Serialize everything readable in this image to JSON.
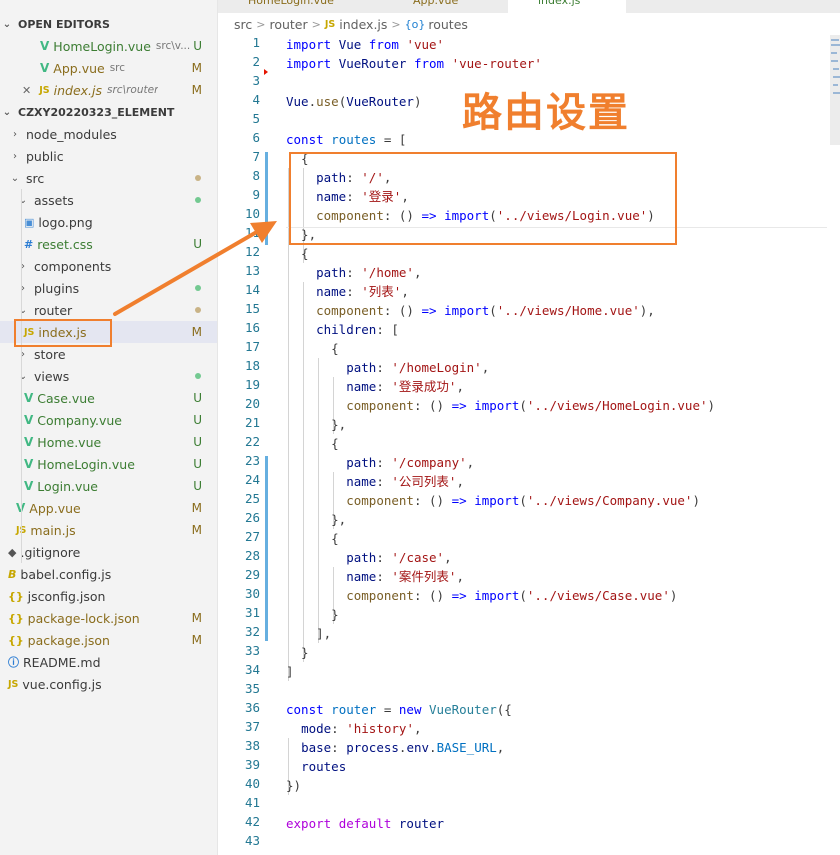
{
  "tabs": [
    {
      "label": "HomeLogin.vue"
    },
    {
      "label": "App.vue"
    },
    {
      "label": "index.js"
    }
  ],
  "breadcrumb": {
    "part1": "src",
    "part2": "router",
    "part3": "index.js",
    "part4": "routes",
    "js_icon": "JS",
    "obj_icon": "{o}"
  },
  "explorer": {
    "open_editors_title": "OPEN EDITORS",
    "project_title": "CZXY20220323_ELEMENT",
    "open_editors": [
      {
        "name": "HomeLogin.vue",
        "path": "src\\v...",
        "status": "U",
        "icon": "vue-icon"
      },
      {
        "name": "App.vue",
        "path": "src",
        "status": "M",
        "icon": "vue-icon"
      },
      {
        "name": "index.js",
        "path": "src\\router",
        "status": "M",
        "icon": "js-icon",
        "close": "✕"
      }
    ],
    "tree": [
      {
        "name": "node_modules",
        "type": "folder",
        "expanded": false
      },
      {
        "name": "public",
        "type": "folder",
        "expanded": false
      },
      {
        "name": "src",
        "type": "folder",
        "expanded": true,
        "dot": "tan"
      },
      {
        "name": "assets",
        "type": "folder",
        "expanded": true,
        "dot": "green"
      },
      {
        "name": "logo.png",
        "type": "file",
        "icon": "image-icon"
      },
      {
        "name": "reset.css",
        "type": "file",
        "icon": "css-icon",
        "status": "U"
      },
      {
        "name": "components",
        "type": "folder",
        "expanded": false
      },
      {
        "name": "plugins",
        "type": "folder",
        "expanded": false,
        "dot": "green"
      },
      {
        "name": "router",
        "type": "folder",
        "expanded": true,
        "dot": "tan"
      },
      {
        "name": "index.js",
        "type": "file",
        "icon": "js-icon",
        "status": "M",
        "selected": true
      },
      {
        "name": "store",
        "type": "folder",
        "expanded": false
      },
      {
        "name": "views",
        "type": "folder",
        "expanded": true,
        "dot": "green"
      },
      {
        "name": "Case.vue",
        "type": "file",
        "icon": "vue-icon",
        "status": "U"
      },
      {
        "name": "Company.vue",
        "type": "file",
        "icon": "vue-icon",
        "status": "U"
      },
      {
        "name": "Home.vue",
        "type": "file",
        "icon": "vue-icon",
        "status": "U"
      },
      {
        "name": "HomeLogin.vue",
        "type": "file",
        "icon": "vue-icon",
        "status": "U"
      },
      {
        "name": "Login.vue",
        "type": "file",
        "icon": "vue-icon",
        "status": "U"
      },
      {
        "name": "App.vue",
        "type": "file",
        "icon": "vue-icon",
        "status": "M"
      },
      {
        "name": "main.js",
        "type": "file",
        "icon": "js-icon",
        "status": "M"
      },
      {
        "name": ".gitignore",
        "type": "file",
        "icon": "git-icon"
      },
      {
        "name": "babel.config.js",
        "type": "file",
        "icon": "babel-icon"
      },
      {
        "name": "jsconfig.json",
        "type": "file",
        "icon": "json-icon"
      },
      {
        "name": "package-lock.json",
        "type": "file",
        "icon": "json-icon",
        "status": "M"
      },
      {
        "name": "package.json",
        "type": "file",
        "icon": "json-icon",
        "status": "M"
      },
      {
        "name": "README.md",
        "type": "file",
        "icon": "info-icon"
      },
      {
        "name": "vue.config.js",
        "type": "file",
        "icon": "js-icon"
      }
    ]
  },
  "overlay_title": "路由设置",
  "code": [
    [
      [
        "kw",
        "import"
      ],
      [
        "pl",
        " "
      ],
      [
        "var",
        "Vue"
      ],
      [
        "pl",
        " "
      ],
      [
        "kw",
        "from"
      ],
      [
        "pl",
        " "
      ],
      [
        "str",
        "'vue'"
      ]
    ],
    [
      [
        "kw",
        "import"
      ],
      [
        "pl",
        " "
      ],
      [
        "var",
        "VueRouter"
      ],
      [
        "pl",
        " "
      ],
      [
        "kw",
        "from"
      ],
      [
        "pl",
        " "
      ],
      [
        "str",
        "'vue-router'"
      ]
    ],
    [],
    [
      [
        "var",
        "Vue"
      ],
      [
        "pl",
        "."
      ],
      [
        "fn",
        "use"
      ],
      [
        "pl",
        "("
      ],
      [
        "var",
        "VueRouter"
      ],
      [
        "pl",
        ")"
      ]
    ],
    [],
    [
      [
        "kw",
        "const"
      ],
      [
        "pl",
        " "
      ],
      [
        "cst",
        "routes"
      ],
      [
        "pl",
        " = ["
      ]
    ],
    [
      [
        "pl",
        "  {"
      ]
    ],
    [
      [
        "pl",
        "    "
      ],
      [
        "prop",
        "path"
      ],
      [
        "pl",
        ": "
      ],
      [
        "str",
        "'/'"
      ],
      [
        "pl",
        ","
      ]
    ],
    [
      [
        "pl",
        "    "
      ],
      [
        "prop",
        "name"
      ],
      [
        "pl",
        ": "
      ],
      [
        "str",
        "'登录'"
      ],
      [
        "pl",
        ","
      ]
    ],
    [
      [
        "pl",
        "    "
      ],
      [
        "fn",
        "component"
      ],
      [
        "pl",
        ": () "
      ],
      [
        "kw",
        "=>"
      ],
      [
        "pl",
        " "
      ],
      [
        "kw",
        "import"
      ],
      [
        "pl",
        "("
      ],
      [
        "str",
        "'../views/Login.vue'"
      ],
      [
        "pl",
        ")"
      ]
    ],
    [
      [
        "pl",
        "  },"
      ]
    ],
    [
      [
        "pl",
        "  {"
      ]
    ],
    [
      [
        "pl",
        "    "
      ],
      [
        "prop",
        "path"
      ],
      [
        "pl",
        ": "
      ],
      [
        "str",
        "'/home'"
      ],
      [
        "pl",
        ","
      ]
    ],
    [
      [
        "pl",
        "    "
      ],
      [
        "prop",
        "name"
      ],
      [
        "pl",
        ": "
      ],
      [
        "str",
        "'列表'"
      ],
      [
        "pl",
        ","
      ]
    ],
    [
      [
        "pl",
        "    "
      ],
      [
        "fn",
        "component"
      ],
      [
        "pl",
        ": () "
      ],
      [
        "kw",
        "=>"
      ],
      [
        "pl",
        " "
      ],
      [
        "kw",
        "import"
      ],
      [
        "pl",
        "("
      ],
      [
        "str",
        "'../views/Home.vue'"
      ],
      [
        "pl",
        "),"
      ]
    ],
    [
      [
        "pl",
        "    "
      ],
      [
        "prop",
        "children"
      ],
      [
        "pl",
        ": ["
      ]
    ],
    [
      [
        "pl",
        "      {"
      ]
    ],
    [
      [
        "pl",
        "        "
      ],
      [
        "prop",
        "path"
      ],
      [
        "pl",
        ": "
      ],
      [
        "str",
        "'/homeLogin'"
      ],
      [
        "pl",
        ","
      ]
    ],
    [
      [
        "pl",
        "        "
      ],
      [
        "prop",
        "name"
      ],
      [
        "pl",
        ": "
      ],
      [
        "str",
        "'登录成功'"
      ],
      [
        "pl",
        ","
      ]
    ],
    [
      [
        "pl",
        "        "
      ],
      [
        "fn",
        "component"
      ],
      [
        "pl",
        ": () "
      ],
      [
        "kw",
        "=>"
      ],
      [
        "pl",
        " "
      ],
      [
        "kw",
        "import"
      ],
      [
        "pl",
        "("
      ],
      [
        "str",
        "'../views/HomeLogin.vue'"
      ],
      [
        "pl",
        ")"
      ]
    ],
    [
      [
        "pl",
        "      },"
      ]
    ],
    [
      [
        "pl",
        "      {"
      ]
    ],
    [
      [
        "pl",
        "        "
      ],
      [
        "prop",
        "path"
      ],
      [
        "pl",
        ": "
      ],
      [
        "str",
        "'/company'"
      ],
      [
        "pl",
        ","
      ]
    ],
    [
      [
        "pl",
        "        "
      ],
      [
        "prop",
        "name"
      ],
      [
        "pl",
        ": "
      ],
      [
        "str",
        "'公司列表'"
      ],
      [
        "pl",
        ","
      ]
    ],
    [
      [
        "pl",
        "        "
      ],
      [
        "fn",
        "component"
      ],
      [
        "pl",
        ": () "
      ],
      [
        "kw",
        "=>"
      ],
      [
        "pl",
        " "
      ],
      [
        "kw",
        "import"
      ],
      [
        "pl",
        "("
      ],
      [
        "str",
        "'../views/Company.vue'"
      ],
      [
        "pl",
        ")"
      ]
    ],
    [
      [
        "pl",
        "      },"
      ]
    ],
    [
      [
        "pl",
        "      {"
      ]
    ],
    [
      [
        "pl",
        "        "
      ],
      [
        "prop",
        "path"
      ],
      [
        "pl",
        ": "
      ],
      [
        "str",
        "'/case'"
      ],
      [
        "pl",
        ","
      ]
    ],
    [
      [
        "pl",
        "        "
      ],
      [
        "prop",
        "name"
      ],
      [
        "pl",
        ": "
      ],
      [
        "str",
        "'案件列表'"
      ],
      [
        "pl",
        ","
      ]
    ],
    [
      [
        "pl",
        "        "
      ],
      [
        "fn",
        "component"
      ],
      [
        "pl",
        ": () "
      ],
      [
        "kw",
        "=>"
      ],
      [
        "pl",
        " "
      ],
      [
        "kw",
        "import"
      ],
      [
        "pl",
        "("
      ],
      [
        "str",
        "'../views/Case.vue'"
      ],
      [
        "pl",
        ")"
      ]
    ],
    [
      [
        "pl",
        "      }"
      ]
    ],
    [
      [
        "pl",
        "    ],"
      ]
    ],
    [
      [
        "pl",
        "  }"
      ]
    ],
    [
      [
        "pl",
        "]"
      ]
    ],
    [],
    [
      [
        "kw",
        "const"
      ],
      [
        "pl",
        " "
      ],
      [
        "cst",
        "router"
      ],
      [
        "pl",
        " = "
      ],
      [
        "kw",
        "new"
      ],
      [
        "pl",
        " "
      ],
      [
        "cls",
        "VueRouter"
      ],
      [
        "pl",
        "({"
      ]
    ],
    [
      [
        "pl",
        "  "
      ],
      [
        "prop",
        "mode"
      ],
      [
        "pl",
        ": "
      ],
      [
        "str",
        "'history'"
      ],
      [
        "pl",
        ","
      ]
    ],
    [
      [
        "pl",
        "  "
      ],
      [
        "prop",
        "base"
      ],
      [
        "pl",
        ": "
      ],
      [
        "var",
        "process"
      ],
      [
        "pl",
        "."
      ],
      [
        "var",
        "env"
      ],
      [
        "pl",
        "."
      ],
      [
        "cst",
        "BASE_URL"
      ],
      [
        "pl",
        ","
      ]
    ],
    [
      [
        "pl",
        "  "
      ],
      [
        "prop",
        "routes"
      ]
    ],
    [
      [
        "pl",
        "})"
      ]
    ],
    [],
    [
      [
        "ctl",
        "export"
      ],
      [
        "pl",
        " "
      ],
      [
        "ctl",
        "default"
      ],
      [
        "pl",
        " "
      ],
      [
        "var",
        "router"
      ]
    ],
    []
  ],
  "colors": {
    "accent_orange": "#f07f2e",
    "untracked": "#3c7d33",
    "modified": "#8a6d1d",
    "keyword": "#0000ff",
    "string": "#a31515",
    "line_number": "#237893"
  }
}
